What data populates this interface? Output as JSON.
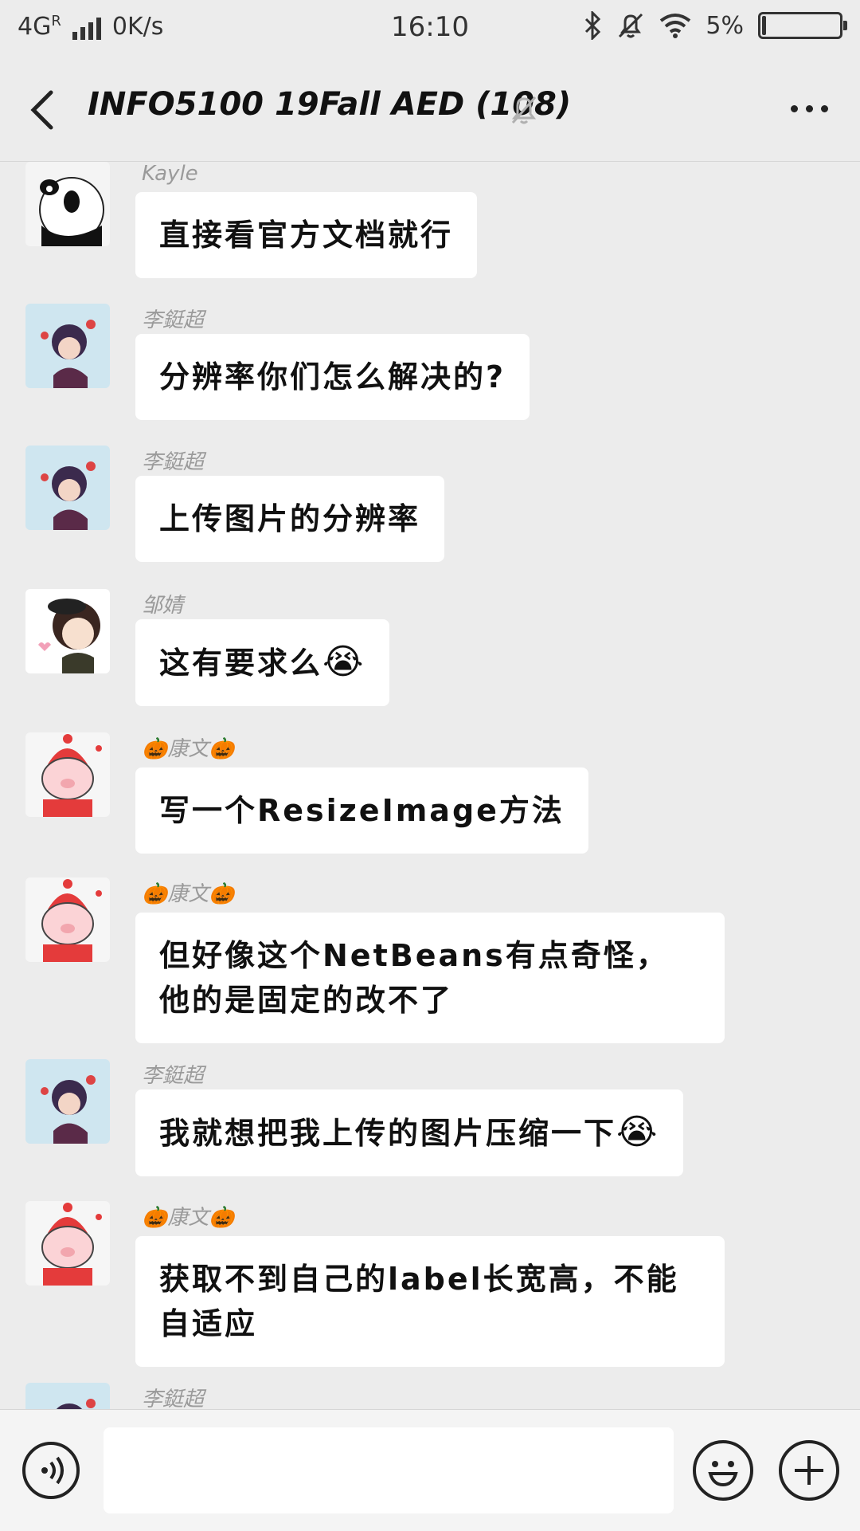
{
  "status_bar": {
    "network": "4G",
    "roaming": "R",
    "speed": "0K/s",
    "time": "16:10",
    "battery": "5%",
    "battery_level": 0.05
  },
  "header": {
    "title": "INFO5100 19Fall AED (108)",
    "back_icon": "chevron-left-icon",
    "mute_icon": "bell-off-icon",
    "more_icon": "more-dots-icon"
  },
  "messages": [
    {
      "sender": "Kayle",
      "text": "直接看官方文档就行",
      "avatar": "panda"
    },
    {
      "sender": "李鋌超",
      "text": "分辨率你们怎么解决的?",
      "avatar": "anime-girl"
    },
    {
      "sender": "李鋌超",
      "text": "上传图片的分辨率",
      "avatar": "anime-girl"
    },
    {
      "sender": "邹婧",
      "text": "这有要求么",
      "emoji": "😭",
      "avatar": "cartoon-girl"
    },
    {
      "sender": "🎃康文🎃",
      "text": "写一个ResizeImage方法",
      "avatar": "pig"
    },
    {
      "sender": "🎃康文🎃",
      "text": "但好像这个NetBeans有点奇怪，他的是固定的改不了",
      "avatar": "pig"
    },
    {
      "sender": "李鋌超",
      "text": "我就想把我上传的图片压缩一下",
      "emoji": "😭",
      "avatar": "anime-girl"
    },
    {
      "sender": "🎃康文🎃",
      "text": "获取不到自己的label长宽高，不能自适应",
      "avatar": "pig"
    },
    {
      "sender": "李鋌超",
      "text": "",
      "avatar": "anime-girl"
    }
  ],
  "input_bar": {
    "voice_icon": "voice-icon",
    "input_placeholder": "",
    "emoji_icon": "smiley-icon",
    "plus_icon": "plus-icon"
  }
}
